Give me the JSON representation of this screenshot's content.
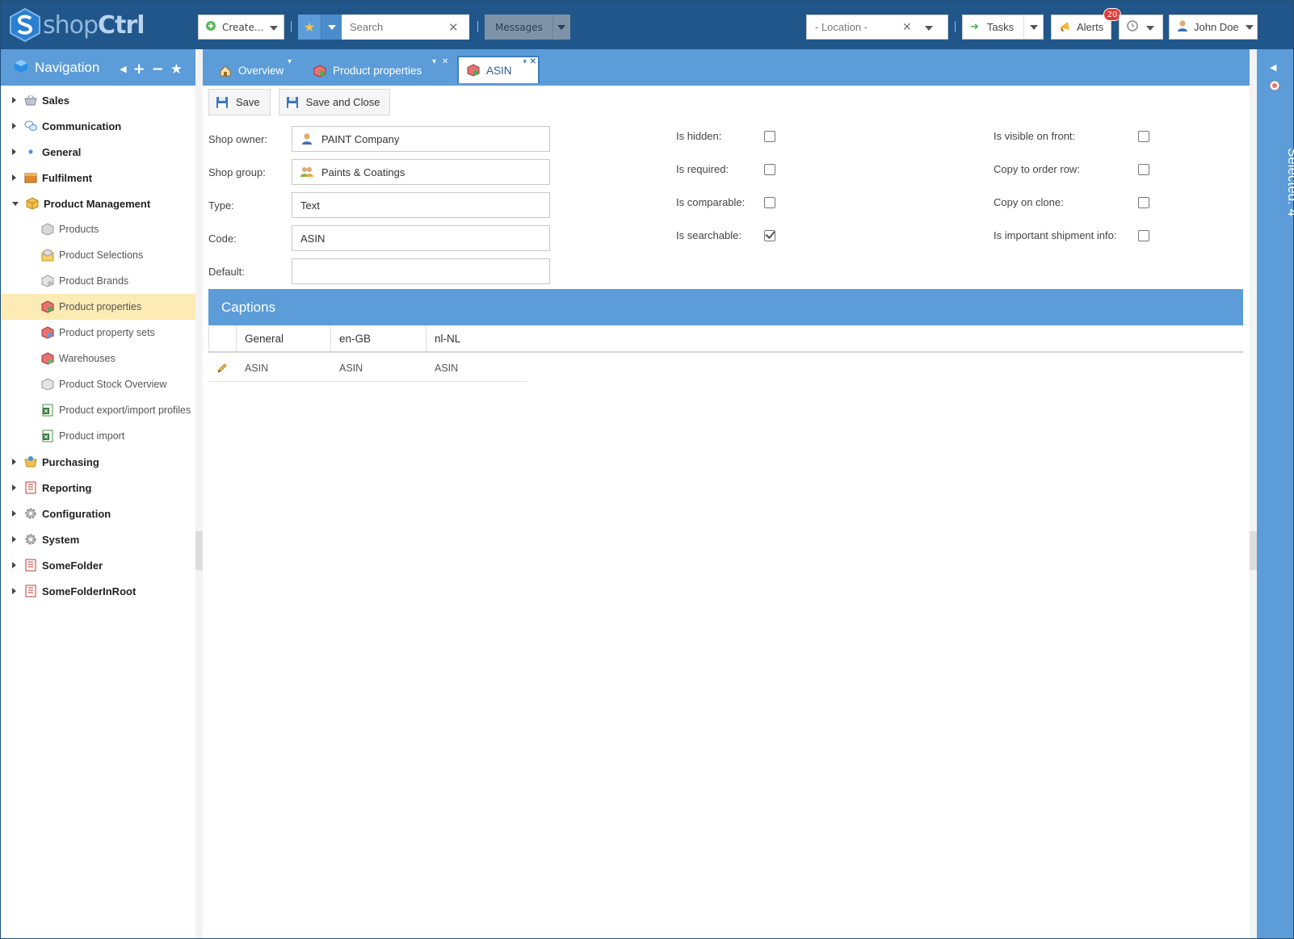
{
  "app": {
    "logo_a": "shop",
    "logo_b": "Ctrl"
  },
  "topbar": {
    "create_label": "Create...",
    "search_placeholder": "Search",
    "messages_label": "Messages",
    "location_placeholder": "- Location -",
    "tasks_label": "Tasks",
    "alerts_label": "Alerts",
    "alerts_count": "20",
    "user_name": "John Doe"
  },
  "nav": {
    "title": "Navigation",
    "items": [
      {
        "label": "Sales"
      },
      {
        "label": "Communication"
      },
      {
        "label": "General"
      },
      {
        "label": "Fulfilment"
      },
      {
        "label": "Product Management"
      },
      {
        "label": "Products"
      },
      {
        "label": "Product Selections"
      },
      {
        "label": "Product Brands"
      },
      {
        "label": "Product properties"
      },
      {
        "label": "Product property sets"
      },
      {
        "label": "Warehouses"
      },
      {
        "label": "Product Stock Overview"
      },
      {
        "label": "Product export/import profiles"
      },
      {
        "label": "Product import"
      },
      {
        "label": "Purchasing"
      },
      {
        "label": "Reporting"
      },
      {
        "label": "Configuration"
      },
      {
        "label": "System"
      },
      {
        "label": "SomeFolder"
      },
      {
        "label": "SomeFolderInRoot"
      }
    ]
  },
  "tabs": [
    {
      "label": "Overview"
    },
    {
      "label": "Product properties"
    },
    {
      "label": "ASIN"
    }
  ],
  "toolbar": {
    "save_label": "Save",
    "save_close_label": "Save and Close"
  },
  "form": {
    "shop_owner": {
      "label": "Shop owner:",
      "value": "PAINT Company"
    },
    "shop_group": {
      "label": "Shop group:",
      "value": "Paints & Coatings"
    },
    "type": {
      "label": "Type:",
      "value": "Text"
    },
    "code": {
      "label": "Code:",
      "value": "ASIN"
    },
    "default": {
      "label": "Default:",
      "value": ""
    },
    "checks_mid": [
      {
        "label": "Is hidden:",
        "checked": false
      },
      {
        "label": "Is required:",
        "checked": false
      },
      {
        "label": "Is comparable:",
        "checked": false
      },
      {
        "label": "Is searchable:",
        "checked": true
      }
    ],
    "checks_right": [
      {
        "label": "Is visible on front:",
        "checked": false
      },
      {
        "label": "Copy to order row:",
        "checked": false
      },
      {
        "label": "Copy on clone:",
        "checked": false
      },
      {
        "label": "Is important shipment info:",
        "checked": false
      }
    ]
  },
  "captions": {
    "title": "Captions",
    "columns": [
      "General",
      "en-GB",
      "nl-NL"
    ],
    "rows": [
      [
        "ASIN",
        "ASIN",
        "ASIN"
      ]
    ]
  },
  "right_panel": {
    "label": "Selected: 4"
  },
  "colors": {
    "topbar": "#21568a",
    "accent": "#5b9cd9",
    "selected_row": "#fcebb4",
    "badge": "#e53935"
  }
}
